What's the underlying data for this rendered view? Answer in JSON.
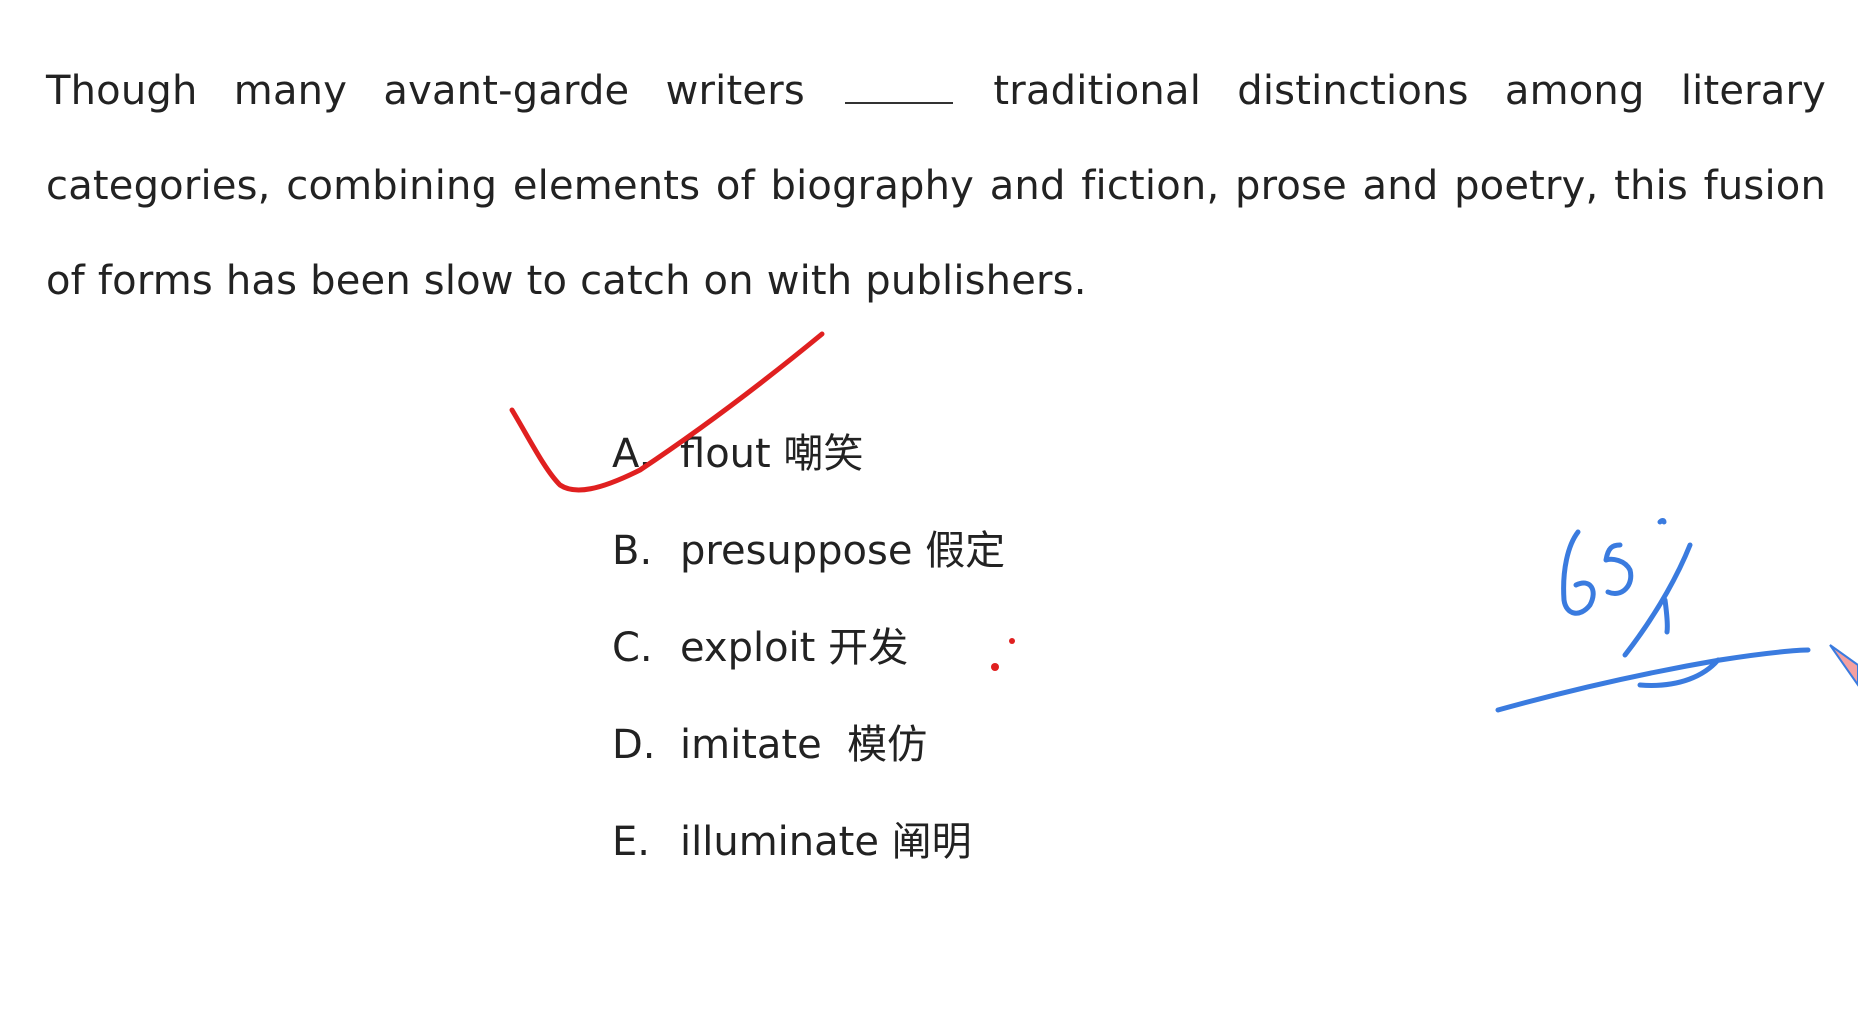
{
  "question": {
    "sentence_before_blank": "Though many avant-garde writers",
    "sentence_after_blank": "traditional distinctions among literary categories, combining elements of biography and fiction, prose and poetry, this fusion of forms has been slow to catch on with publishers."
  },
  "options": [
    {
      "letter": "A.",
      "word": "flout",
      "translation": "嘲笑"
    },
    {
      "letter": "B.",
      "word": "presuppose",
      "translation": "假定"
    },
    {
      "letter": "C.",
      "word": "exploit",
      "translation": "开发"
    },
    {
      "letter": "D.",
      "word": "imitate",
      "translation": "模仿"
    },
    {
      "letter": "E.",
      "word": "illuminate",
      "translation": "阐明"
    }
  ],
  "annotations": {
    "handwritten_note": "65%",
    "checkmark_color": "#e02020",
    "note_color": "#3a7bdf",
    "marked_option": "A"
  }
}
